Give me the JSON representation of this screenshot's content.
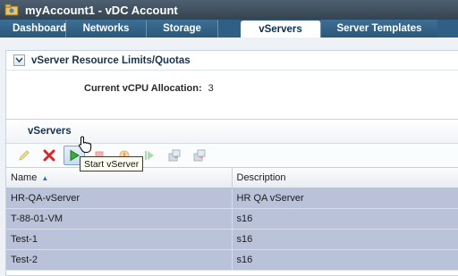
{
  "window": {
    "title": "myAccount1 - vDC Account"
  },
  "tabs": [
    {
      "label": "Dashboard"
    },
    {
      "label": "Networks"
    },
    {
      "label": "Storage"
    },
    {
      "label": "vServers",
      "active": true
    },
    {
      "label": "Server Templates"
    }
  ],
  "limits_panel": {
    "title": "vServer Resource Limits/Quotas",
    "allocation_label": "Current vCPU Allocation:",
    "allocation_value": "3"
  },
  "vservers_panel": {
    "title": "vServers",
    "toolbar": [
      {
        "icon": "edit-icon",
        "enabled": false
      },
      {
        "icon": "delete-icon",
        "enabled": true
      },
      {
        "icon": "start-icon",
        "enabled": true,
        "hovered": true
      },
      {
        "icon": "stop-icon",
        "enabled": false
      },
      {
        "icon": "reboot-icon",
        "enabled": false
      },
      {
        "icon": "resume-icon",
        "enabled": false
      },
      {
        "icon": "attach-icon",
        "enabled": false
      },
      {
        "icon": "detach-icon",
        "enabled": false
      }
    ],
    "tooltip": "Start vServer",
    "columns": [
      "Name",
      "Description"
    ],
    "sort": {
      "column": "Name",
      "direction": "ascending"
    },
    "rows": [
      {
        "name": "HR-QA-vServer",
        "description": "HR QA vServer"
      },
      {
        "name": "T-88-01-VM",
        "description": "s16"
      },
      {
        "name": "Test-1",
        "description": "s16"
      },
      {
        "name": "Test-2",
        "description": "s16"
      }
    ]
  },
  "colors": {
    "titlebar": "#3f4f5e",
    "tabbar": "#2f5f84",
    "selected_row": "#b9c2d9",
    "delete_red": "#d8262a",
    "start_green": "#3bab3b"
  }
}
